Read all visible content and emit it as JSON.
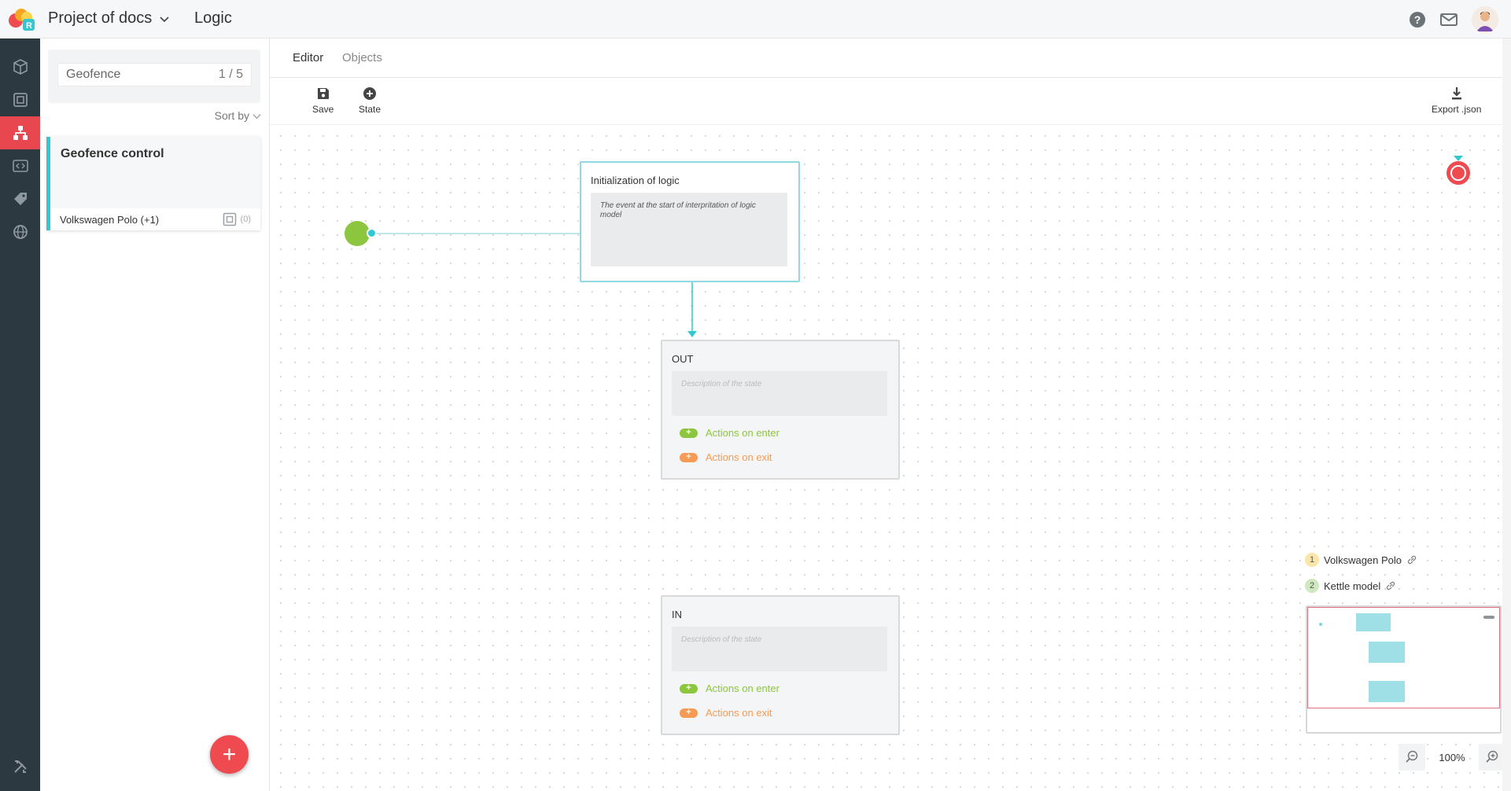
{
  "header": {
    "project_name": "Project of docs",
    "section_title": "Logic",
    "icons": [
      "logo-icon",
      "chevron-down-icon",
      "help-icon",
      "mail-icon",
      "avatar"
    ]
  },
  "rail": {
    "items": [
      {
        "icon": "cube-icon",
        "active": false
      },
      {
        "icon": "square-frame-icon",
        "active": false
      },
      {
        "icon": "hierarchy-icon",
        "active": true
      },
      {
        "icon": "code-frame-icon",
        "active": false
      },
      {
        "icon": "tag-icon",
        "active": false
      },
      {
        "icon": "globe-icon",
        "active": false
      },
      {
        "icon": "tools-icon",
        "active": false
      }
    ],
    "active_color": "#e8474f",
    "bg_color": "#2d3941"
  },
  "list": {
    "search_value": "Geofence",
    "search_count": "1 / 5",
    "sort_label": "Sort by",
    "cards": [
      {
        "title": "Geofence control",
        "objects": "Volkswagen Polo (+1)",
        "count": "(0)"
      }
    ],
    "add_button": "+"
  },
  "tabs": [
    {
      "label": "Editor",
      "active": true
    },
    {
      "label": "Objects",
      "active": false
    }
  ],
  "toolbar": {
    "save_label": "Save",
    "state_label": "State",
    "export_label": "Export .json"
  },
  "canvas": {
    "init_node": {
      "title": "Initialization of logic",
      "description": "The event at the start of interpritation of logic model"
    },
    "states": [
      {
        "title": "OUT",
        "description_placeholder": "Description of the state",
        "enter_label": "Actions on enter",
        "exit_label": "Actions on exit",
        "plus": "+"
      },
      {
        "title": "IN",
        "description_placeholder": "Description of the state",
        "enter_label": "Actions on enter",
        "exit_label": "Actions on exit",
        "plus": "+"
      }
    ],
    "legend": [
      {
        "num": "1",
        "label": "Volkswagen Polo",
        "color": "#fbe6a8"
      },
      {
        "num": "2",
        "label": "Kettle model",
        "color": "#cfe8bf"
      }
    ],
    "zoom_level": "100%"
  },
  "colors": {
    "accent_teal": "#33c7d1",
    "start_green": "#8cc63f",
    "enter_green": "#8cc63f",
    "exit_orange": "#f59b55",
    "end_red": "#ee4a50",
    "fab_red": "#ee4a50"
  }
}
